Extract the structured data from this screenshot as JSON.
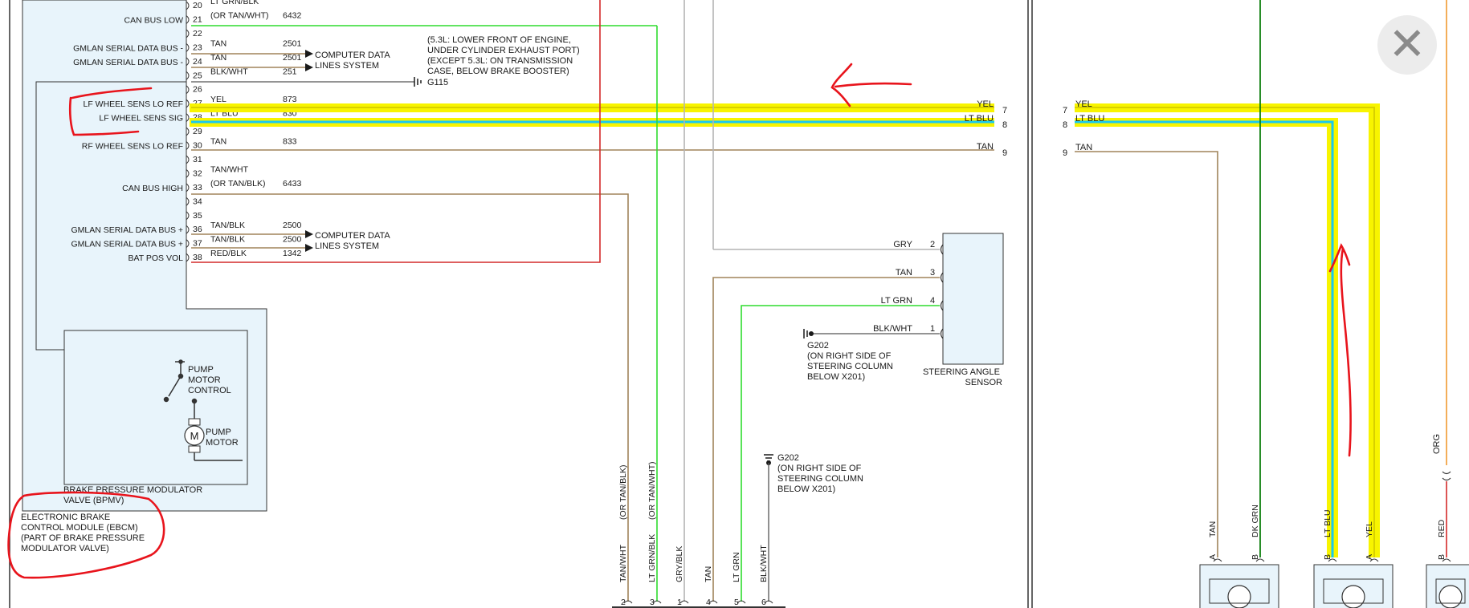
{
  "close_label": "✕",
  "colors": {
    "module_fill": "#e8f4fb",
    "yellow_hl": "#f8f400",
    "cyan": "#19c9f0",
    "lt_grn": "#2fdc2f",
    "dk_grn": "#108010",
    "tan": "#a0845a",
    "gry": "#b4b4b4",
    "red_wire": "#d42a2a",
    "red_ink": "#e8141c",
    "org": "#f09a30"
  },
  "module": {
    "pins": [
      {
        "pin": "20",
        "label": "",
        "color": "LT GRN/BLK",
        "circuit": ""
      },
      {
        "pin": "21",
        "label": "CAN BUS LOW",
        "color": "(OR TAN/WHT)",
        "circuit": "6432"
      },
      {
        "pin": "22",
        "label": "",
        "color": "",
        "circuit": ""
      },
      {
        "pin": "23",
        "label": "GMLAN SERIAL DATA BUS -",
        "color": "TAN",
        "circuit": "2501"
      },
      {
        "pin": "24",
        "label": "GMLAN SERIAL DATA BUS -",
        "color": "TAN",
        "circuit": "2501"
      },
      {
        "pin": "25",
        "label": "",
        "color": "BLK/WHT",
        "circuit": "251"
      },
      {
        "pin": "26",
        "label": "",
        "color": "",
        "circuit": ""
      },
      {
        "pin": "27",
        "label": "LF WHEEL SENS LO REF",
        "color": "YEL",
        "circuit": "873"
      },
      {
        "pin": "28",
        "label": "LF WHEEL SENS SIG",
        "color": "LT BLU",
        "circuit": "830"
      },
      {
        "pin": "29",
        "label": "",
        "color": "",
        "circuit": ""
      },
      {
        "pin": "30",
        "label": "RF WHEEL SENS LO REF",
        "color": "TAN",
        "circuit": "833"
      },
      {
        "pin": "31",
        "label": "",
        "color": "",
        "circuit": ""
      },
      {
        "pin": "32",
        "label": "",
        "color": "TAN/WHT",
        "circuit": ""
      },
      {
        "pin": "33",
        "label": "CAN BUS HIGH",
        "color": "(OR TAN/BLK)",
        "circuit": "6433"
      },
      {
        "pin": "34",
        "label": "",
        "color": "",
        "circuit": ""
      },
      {
        "pin": "35",
        "label": "",
        "color": "",
        "circuit": ""
      },
      {
        "pin": "36",
        "label": "GMLAN SERIAL DATA BUS +",
        "color": "TAN/BLK",
        "circuit": "2500"
      },
      {
        "pin": "37",
        "label": "GMLAN SERIAL DATA BUS +",
        "color": "TAN/BLK",
        "circuit": "2500"
      },
      {
        "pin": "38",
        "label": "BAT POS VOL",
        "color": "RED/BLK",
        "circuit": "1342"
      }
    ],
    "computer_data": [
      "COMPUTER DATA",
      "LINES SYSTEM"
    ],
    "g115": "G115",
    "g115_note": [
      "(5.3L: LOWER FRONT OF ENGINE,",
      "UNDER CYLINDER EXHAUST PORT)",
      "(EXCEPT 5.3L: ON TRANSMISSION",
      "CASE, BELOW BRAKE BOOSTER)"
    ],
    "pump_motor_control": [
      "PUMP",
      "MOTOR",
      "CONTROL"
    ],
    "pump_motor": [
      "PUMP",
      "MOTOR"
    ],
    "motor_symbol": "M",
    "bpmv_label": [
      "BRAKE PRESSURE MODULATOR",
      "VALVE (BPMV)"
    ],
    "ebcm_label": [
      "ELECTRONIC BRAKE",
      "CONTROL MODULE (EBCM)",
      "(PART OF BRAKE PRESSURE",
      "MODULATOR VALVE)"
    ]
  },
  "splice_right": [
    {
      "color": "YEL",
      "pin": "7"
    },
    {
      "color": "LT BLU",
      "pin": "8"
    },
    {
      "color": "TAN",
      "pin": "9"
    }
  ],
  "steering": {
    "pins": [
      {
        "color": "GRY",
        "pin": "2"
      },
      {
        "color": "TAN",
        "pin": "3"
      },
      {
        "color": "LT GRN",
        "pin": "4"
      },
      {
        "color": "BLK/WHT",
        "pin": "1"
      }
    ],
    "label": [
      "STEERING ANGLE",
      "SENSOR"
    ],
    "g202_a": [
      "G202",
      "(ON RIGHT SIDE OF",
      "STEERING COLUMN",
      "BELOW X201)"
    ],
    "g202_b": [
      "G202",
      "(ON RIGHT SIDE OF",
      "STEERING COLUMN",
      "BELOW X201)"
    ]
  },
  "bottom_connector": [
    {
      "pin": "2",
      "color": "TAN/WHT",
      "alt": "(OR TAN/BLK)"
    },
    {
      "pin": "3",
      "color": "LT GRN/BLK",
      "alt": "(OR TAN/WHT)"
    },
    {
      "pin": "1",
      "color": "GRY/BLK",
      "alt": ""
    },
    {
      "pin": "4",
      "color": "TAN",
      "alt": ""
    },
    {
      "pin": "5",
      "color": "LT GRN",
      "alt": ""
    },
    {
      "pin": "6",
      "color": "BLK/WHT",
      "alt": ""
    }
  ],
  "right_panel": {
    "left_pins": [
      {
        "pin": "7",
        "color": "YEL"
      },
      {
        "pin": "8",
        "color": "LT BLU"
      },
      {
        "pin": "9",
        "color": "TAN"
      }
    ],
    "sensor_a": [
      {
        "color": "TAN",
        "pin": "A"
      },
      {
        "color": "DK GRN",
        "pin": "B"
      }
    ],
    "sensor_b": [
      {
        "color": "LT BLU",
        "pin": "B"
      },
      {
        "color": "YEL",
        "pin": "A"
      }
    ],
    "sensor_c": [
      {
        "color": "RED",
        "pin": "B"
      }
    ],
    "org": "ORG"
  }
}
